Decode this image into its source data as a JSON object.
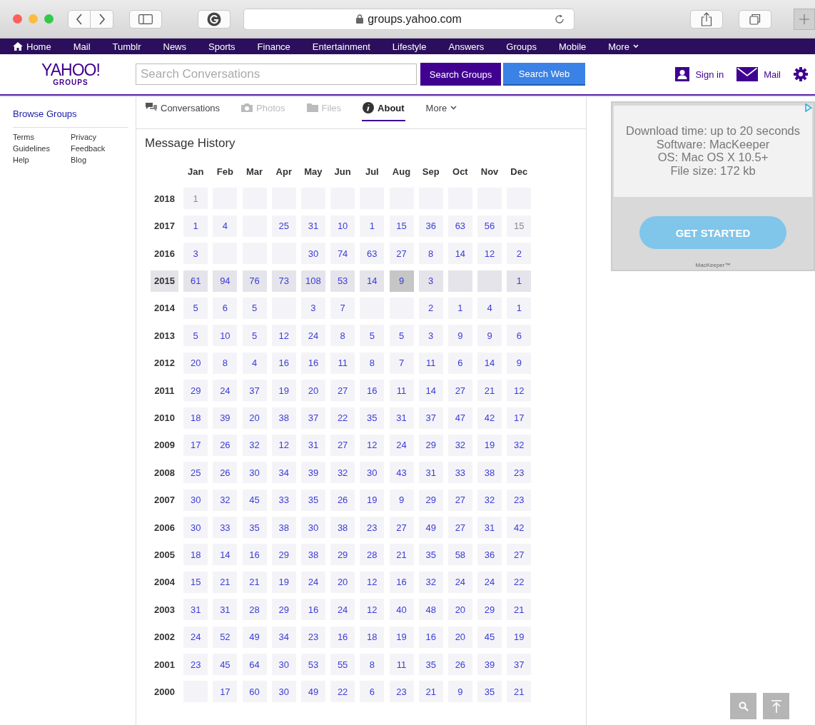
{
  "browser": {
    "address": "groups.yahoo.com"
  },
  "top_nav": [
    "Home",
    "Mail",
    "Tumblr",
    "News",
    "Sports",
    "Finance",
    "Entertainment",
    "Lifestyle",
    "Answers",
    "Groups",
    "Mobile",
    "More"
  ],
  "header": {
    "logo": "YAHOO!",
    "logo_sub": "GROUPS",
    "search": {
      "placeholder": "Search Conversations"
    },
    "buttons": [
      "Search Groups",
      "Search Web"
    ],
    "sign_in": "Sign in",
    "mail": "Mail"
  },
  "sidebar": {
    "title": "Browse Groups",
    "links": [
      "Terms",
      "Privacy",
      "Guidelines",
      "Feedback",
      "Help",
      "Blog"
    ]
  },
  "tabs": [
    {
      "label": "Conversations",
      "selected": false,
      "disabled": false
    },
    {
      "label": "Photos",
      "selected": false,
      "disabled": true
    },
    {
      "label": "Files",
      "selected": false,
      "disabled": true
    },
    {
      "label": "About",
      "selected": true,
      "disabled": false
    },
    {
      "label": "More",
      "selected": false,
      "disabled": false
    }
  ],
  "history": {
    "title": "Message History",
    "months": [
      "Jan",
      "Feb",
      "Mar",
      "Apr",
      "May",
      "Jun",
      "Jul",
      "Aug",
      "Sep",
      "Oct",
      "Nov",
      "Dec"
    ],
    "rows": [
      {
        "year": "2018",
        "selected": false,
        "cells": [
          {
            "kind": "count",
            "count": "1",
            "selected": false,
            "disabled": true
          },
          {
            "kind": "empty"
          },
          {
            "kind": "empty"
          },
          {
            "kind": "empty"
          },
          {
            "kind": "empty"
          },
          {
            "kind": "empty"
          },
          {
            "kind": "empty"
          },
          {
            "kind": "empty"
          },
          {
            "kind": "empty"
          },
          {
            "kind": "empty"
          },
          {
            "kind": "empty"
          },
          {
            "kind": "empty"
          }
        ]
      },
      {
        "year": "2017",
        "selected": false,
        "cells": [
          {
            "kind": "count",
            "count": "1",
            "selected": false,
            "disabled": false
          },
          {
            "kind": "count",
            "count": "4",
            "selected": false,
            "disabled": false
          },
          {
            "kind": "empty"
          },
          {
            "kind": "count",
            "count": "25",
            "selected": false,
            "disabled": false
          },
          {
            "kind": "count",
            "count": "31",
            "selected": false,
            "disabled": false
          },
          {
            "kind": "count",
            "count": "10",
            "selected": false,
            "disabled": false
          },
          {
            "kind": "count",
            "count": "1",
            "selected": false,
            "disabled": false
          },
          {
            "kind": "count",
            "count": "15",
            "selected": false,
            "disabled": false
          },
          {
            "kind": "count",
            "count": "36",
            "selected": false,
            "disabled": false
          },
          {
            "kind": "count",
            "count": "63",
            "selected": false,
            "disabled": false
          },
          {
            "kind": "count",
            "count": "56",
            "selected": false,
            "disabled": false
          },
          {
            "kind": "count",
            "count": "15",
            "selected": false,
            "disabled": true
          }
        ]
      },
      {
        "year": "2016",
        "selected": false,
        "cells": [
          {
            "kind": "count",
            "count": "3",
            "selected": false,
            "disabled": false
          },
          {
            "kind": "empty"
          },
          {
            "kind": "empty"
          },
          {
            "kind": "empty"
          },
          {
            "kind": "count",
            "count": "30",
            "selected": false,
            "disabled": false
          },
          {
            "kind": "count",
            "count": "74",
            "selected": false,
            "disabled": false
          },
          {
            "kind": "count",
            "count": "63",
            "selected": false,
            "disabled": false
          },
          {
            "kind": "count",
            "count": "27",
            "selected": false,
            "disabled": false
          },
          {
            "kind": "count",
            "count": "8",
            "selected": false,
            "disabled": false
          },
          {
            "kind": "count",
            "count": "14",
            "selected": false,
            "disabled": false
          },
          {
            "kind": "count",
            "count": "12",
            "selected": false,
            "disabled": false
          },
          {
            "kind": "count",
            "count": "2",
            "selected": false,
            "disabled": false
          }
        ]
      },
      {
        "year": "2015",
        "selected": true,
        "cells": [
          {
            "kind": "count",
            "count": "61",
            "selected": false,
            "disabled": false
          },
          {
            "kind": "count",
            "count": "94",
            "selected": false,
            "disabled": false
          },
          {
            "kind": "count",
            "count": "76",
            "selected": false,
            "disabled": false
          },
          {
            "kind": "count",
            "count": "73",
            "selected": false,
            "disabled": false
          },
          {
            "kind": "count",
            "count": "108",
            "selected": false,
            "disabled": false
          },
          {
            "kind": "count",
            "count": "53",
            "selected": false,
            "disabled": false
          },
          {
            "kind": "count",
            "count": "14",
            "selected": false,
            "disabled": false
          },
          {
            "kind": "count",
            "count": "9",
            "selected": true,
            "disabled": false
          },
          {
            "kind": "count",
            "count": "3",
            "selected": false,
            "disabled": false
          },
          {
            "kind": "empty"
          },
          {
            "kind": "empty"
          },
          {
            "kind": "count",
            "count": "1",
            "selected": false,
            "disabled": false
          }
        ]
      },
      {
        "year": "2014",
        "selected": false,
        "cells": [
          {
            "kind": "count",
            "count": "5",
            "selected": false,
            "disabled": false
          },
          {
            "kind": "count",
            "count": "6",
            "selected": false,
            "disabled": false
          },
          {
            "kind": "count",
            "count": "5",
            "selected": false,
            "disabled": false
          },
          {
            "kind": "empty"
          },
          {
            "kind": "count",
            "count": "3",
            "selected": false,
            "disabled": false
          },
          {
            "kind": "count",
            "count": "7",
            "selected": false,
            "disabled": false
          },
          {
            "kind": "empty"
          },
          {
            "kind": "empty"
          },
          {
            "kind": "count",
            "count": "2",
            "selected": false,
            "disabled": false
          },
          {
            "kind": "count",
            "count": "1",
            "selected": false,
            "disabled": false
          },
          {
            "kind": "count",
            "count": "4",
            "selected": false,
            "disabled": false
          },
          {
            "kind": "count",
            "count": "1",
            "selected": false,
            "disabled": false
          }
        ]
      },
      {
        "year": "2013",
        "selected": false,
        "cells": [
          {
            "kind": "count",
            "count": "5",
            "selected": false,
            "disabled": false
          },
          {
            "kind": "count",
            "count": "10",
            "selected": false,
            "disabled": false
          },
          {
            "kind": "count",
            "count": "5",
            "selected": false,
            "disabled": false
          },
          {
            "kind": "count",
            "count": "12",
            "selected": false,
            "disabled": false
          },
          {
            "kind": "count",
            "count": "24",
            "selected": false,
            "disabled": false
          },
          {
            "kind": "count",
            "count": "8",
            "selected": false,
            "disabled": false
          },
          {
            "kind": "count",
            "count": "5",
            "selected": false,
            "disabled": false
          },
          {
            "kind": "count",
            "count": "5",
            "selected": false,
            "disabled": false
          },
          {
            "kind": "count",
            "count": "3",
            "selected": false,
            "disabled": false
          },
          {
            "kind": "count",
            "count": "9",
            "selected": false,
            "disabled": false
          },
          {
            "kind": "count",
            "count": "9",
            "selected": false,
            "disabled": false
          },
          {
            "kind": "count",
            "count": "6",
            "selected": false,
            "disabled": false
          }
        ]
      },
      {
        "year": "2012",
        "selected": false,
        "cells": [
          {
            "kind": "count",
            "count": "20",
            "selected": false,
            "disabled": false
          },
          {
            "kind": "count",
            "count": "8",
            "selected": false,
            "disabled": false
          },
          {
            "kind": "count",
            "count": "4",
            "selected": false,
            "disabled": false
          },
          {
            "kind": "count",
            "count": "16",
            "selected": false,
            "disabled": false
          },
          {
            "kind": "count",
            "count": "16",
            "selected": false,
            "disabled": false
          },
          {
            "kind": "count",
            "count": "11",
            "selected": false,
            "disabled": false
          },
          {
            "kind": "count",
            "count": "8",
            "selected": false,
            "disabled": false
          },
          {
            "kind": "count",
            "count": "7",
            "selected": false,
            "disabled": false
          },
          {
            "kind": "count",
            "count": "11",
            "selected": false,
            "disabled": false
          },
          {
            "kind": "count",
            "count": "6",
            "selected": false,
            "disabled": false
          },
          {
            "kind": "count",
            "count": "14",
            "selected": false,
            "disabled": false
          },
          {
            "kind": "count",
            "count": "9",
            "selected": false,
            "disabled": false
          }
        ]
      },
      {
        "year": "2011",
        "selected": false,
        "cells": [
          {
            "kind": "count",
            "count": "29",
            "selected": false,
            "disabled": false
          },
          {
            "kind": "count",
            "count": "24",
            "selected": false,
            "disabled": false
          },
          {
            "kind": "count",
            "count": "37",
            "selected": false,
            "disabled": false
          },
          {
            "kind": "count",
            "count": "19",
            "selected": false,
            "disabled": false
          },
          {
            "kind": "count",
            "count": "20",
            "selected": false,
            "disabled": false
          },
          {
            "kind": "count",
            "count": "27",
            "selected": false,
            "disabled": false
          },
          {
            "kind": "count",
            "count": "16",
            "selected": false,
            "disabled": false
          },
          {
            "kind": "count",
            "count": "11",
            "selected": false,
            "disabled": false
          },
          {
            "kind": "count",
            "count": "14",
            "selected": false,
            "disabled": false
          },
          {
            "kind": "count",
            "count": "27",
            "selected": false,
            "disabled": false
          },
          {
            "kind": "count",
            "count": "21",
            "selected": false,
            "disabled": false
          },
          {
            "kind": "count",
            "count": "12",
            "selected": false,
            "disabled": false
          }
        ]
      },
      {
        "year": "2010",
        "selected": false,
        "cells": [
          {
            "kind": "count",
            "count": "18",
            "selected": false,
            "disabled": false
          },
          {
            "kind": "count",
            "count": "39",
            "selected": false,
            "disabled": false
          },
          {
            "kind": "count",
            "count": "20",
            "selected": false,
            "disabled": false
          },
          {
            "kind": "count",
            "count": "38",
            "selected": false,
            "disabled": false
          },
          {
            "kind": "count",
            "count": "37",
            "selected": false,
            "disabled": false
          },
          {
            "kind": "count",
            "count": "22",
            "selected": false,
            "disabled": false
          },
          {
            "kind": "count",
            "count": "35",
            "selected": false,
            "disabled": false
          },
          {
            "kind": "count",
            "count": "31",
            "selected": false,
            "disabled": false
          },
          {
            "kind": "count",
            "count": "37",
            "selected": false,
            "disabled": false
          },
          {
            "kind": "count",
            "count": "47",
            "selected": false,
            "disabled": false
          },
          {
            "kind": "count",
            "count": "42",
            "selected": false,
            "disabled": false
          },
          {
            "kind": "count",
            "count": "17",
            "selected": false,
            "disabled": false
          }
        ]
      },
      {
        "year": "2009",
        "selected": false,
        "cells": [
          {
            "kind": "count",
            "count": "17",
            "selected": false,
            "disabled": false
          },
          {
            "kind": "count",
            "count": "26",
            "selected": false,
            "disabled": false
          },
          {
            "kind": "count",
            "count": "32",
            "selected": false,
            "disabled": false
          },
          {
            "kind": "count",
            "count": "12",
            "selected": false,
            "disabled": false
          },
          {
            "kind": "count",
            "count": "31",
            "selected": false,
            "disabled": false
          },
          {
            "kind": "count",
            "count": "27",
            "selected": false,
            "disabled": false
          },
          {
            "kind": "count",
            "count": "12",
            "selected": false,
            "disabled": false
          },
          {
            "kind": "count",
            "count": "24",
            "selected": false,
            "disabled": false
          },
          {
            "kind": "count",
            "count": "29",
            "selected": false,
            "disabled": false
          },
          {
            "kind": "count",
            "count": "32",
            "selected": false,
            "disabled": false
          },
          {
            "kind": "count",
            "count": "19",
            "selected": false,
            "disabled": false
          },
          {
            "kind": "count",
            "count": "32",
            "selected": false,
            "disabled": false
          }
        ]
      },
      {
        "year": "2008",
        "selected": false,
        "cells": [
          {
            "kind": "count",
            "count": "25",
            "selected": false,
            "disabled": false
          },
          {
            "kind": "count",
            "count": "26",
            "selected": false,
            "disabled": false
          },
          {
            "kind": "count",
            "count": "30",
            "selected": false,
            "disabled": false
          },
          {
            "kind": "count",
            "count": "34",
            "selected": false,
            "disabled": false
          },
          {
            "kind": "count",
            "count": "39",
            "selected": false,
            "disabled": false
          },
          {
            "kind": "count",
            "count": "32",
            "selected": false,
            "disabled": false
          },
          {
            "kind": "count",
            "count": "30",
            "selected": false,
            "disabled": false
          },
          {
            "kind": "count",
            "count": "43",
            "selected": false,
            "disabled": false
          },
          {
            "kind": "count",
            "count": "31",
            "selected": false,
            "disabled": false
          },
          {
            "kind": "count",
            "count": "33",
            "selected": false,
            "disabled": false
          },
          {
            "kind": "count",
            "count": "38",
            "selected": false,
            "disabled": false
          },
          {
            "kind": "count",
            "count": "23",
            "selected": false,
            "disabled": false
          }
        ]
      },
      {
        "year": "2007",
        "selected": false,
        "cells": [
          {
            "kind": "count",
            "count": "30",
            "selected": false,
            "disabled": false
          },
          {
            "kind": "count",
            "count": "32",
            "selected": false,
            "disabled": false
          },
          {
            "kind": "count",
            "count": "45",
            "selected": false,
            "disabled": false
          },
          {
            "kind": "count",
            "count": "33",
            "selected": false,
            "disabled": false
          },
          {
            "kind": "count",
            "count": "35",
            "selected": false,
            "disabled": false
          },
          {
            "kind": "count",
            "count": "26",
            "selected": false,
            "disabled": false
          },
          {
            "kind": "count",
            "count": "19",
            "selected": false,
            "disabled": false
          },
          {
            "kind": "count",
            "count": "9",
            "selected": false,
            "disabled": false
          },
          {
            "kind": "count",
            "count": "29",
            "selected": false,
            "disabled": false
          },
          {
            "kind": "count",
            "count": "27",
            "selected": false,
            "disabled": false
          },
          {
            "kind": "count",
            "count": "32",
            "selected": false,
            "disabled": false
          },
          {
            "kind": "count",
            "count": "23",
            "selected": false,
            "disabled": false
          }
        ]
      },
      {
        "year": "2006",
        "selected": false,
        "cells": [
          {
            "kind": "count",
            "count": "30",
            "selected": false,
            "disabled": false
          },
          {
            "kind": "count",
            "count": "33",
            "selected": false,
            "disabled": false
          },
          {
            "kind": "count",
            "count": "35",
            "selected": false,
            "disabled": false
          },
          {
            "kind": "count",
            "count": "38",
            "selected": false,
            "disabled": false
          },
          {
            "kind": "count",
            "count": "30",
            "selected": false,
            "disabled": false
          },
          {
            "kind": "count",
            "count": "38",
            "selected": false,
            "disabled": false
          },
          {
            "kind": "count",
            "count": "23",
            "selected": false,
            "disabled": false
          },
          {
            "kind": "count",
            "count": "27",
            "selected": false,
            "disabled": false
          },
          {
            "kind": "count",
            "count": "49",
            "selected": false,
            "disabled": false
          },
          {
            "kind": "count",
            "count": "27",
            "selected": false,
            "disabled": false
          },
          {
            "kind": "count",
            "count": "31",
            "selected": false,
            "disabled": false
          },
          {
            "kind": "count",
            "count": "42",
            "selected": false,
            "disabled": false
          }
        ]
      },
      {
        "year": "2005",
        "selected": false,
        "cells": [
          {
            "kind": "count",
            "count": "18",
            "selected": false,
            "disabled": false
          },
          {
            "kind": "count",
            "count": "14",
            "selected": false,
            "disabled": false
          },
          {
            "kind": "count",
            "count": "16",
            "selected": false,
            "disabled": false
          },
          {
            "kind": "count",
            "count": "29",
            "selected": false,
            "disabled": false
          },
          {
            "kind": "count",
            "count": "38",
            "selected": false,
            "disabled": false
          },
          {
            "kind": "count",
            "count": "29",
            "selected": false,
            "disabled": false
          },
          {
            "kind": "count",
            "count": "28",
            "selected": false,
            "disabled": false
          },
          {
            "kind": "count",
            "count": "21",
            "selected": false,
            "disabled": false
          },
          {
            "kind": "count",
            "count": "35",
            "selected": false,
            "disabled": false
          },
          {
            "kind": "count",
            "count": "58",
            "selected": false,
            "disabled": false
          },
          {
            "kind": "count",
            "count": "36",
            "selected": false,
            "disabled": false
          },
          {
            "kind": "count",
            "count": "27",
            "selected": false,
            "disabled": false
          }
        ]
      },
      {
        "year": "2004",
        "selected": false,
        "cells": [
          {
            "kind": "count",
            "count": "15",
            "selected": false,
            "disabled": false
          },
          {
            "kind": "count",
            "count": "21",
            "selected": false,
            "disabled": false
          },
          {
            "kind": "count",
            "count": "21",
            "selected": false,
            "disabled": false
          },
          {
            "kind": "count",
            "count": "19",
            "selected": false,
            "disabled": false
          },
          {
            "kind": "count",
            "count": "24",
            "selected": false,
            "disabled": false
          },
          {
            "kind": "count",
            "count": "20",
            "selected": false,
            "disabled": false
          },
          {
            "kind": "count",
            "count": "12",
            "selected": false,
            "disabled": false
          },
          {
            "kind": "count",
            "count": "16",
            "selected": false,
            "disabled": false
          },
          {
            "kind": "count",
            "count": "32",
            "selected": false,
            "disabled": false
          },
          {
            "kind": "count",
            "count": "24",
            "selected": false,
            "disabled": false
          },
          {
            "kind": "count",
            "count": "24",
            "selected": false,
            "disabled": false
          },
          {
            "kind": "count",
            "count": "22",
            "selected": false,
            "disabled": false
          }
        ]
      },
      {
        "year": "2003",
        "selected": false,
        "cells": [
          {
            "kind": "count",
            "count": "31",
            "selected": false,
            "disabled": false
          },
          {
            "kind": "count",
            "count": "31",
            "selected": false,
            "disabled": false
          },
          {
            "kind": "count",
            "count": "28",
            "selected": false,
            "disabled": false
          },
          {
            "kind": "count",
            "count": "29",
            "selected": false,
            "disabled": false
          },
          {
            "kind": "count",
            "count": "16",
            "selected": false,
            "disabled": false
          },
          {
            "kind": "count",
            "count": "24",
            "selected": false,
            "disabled": false
          },
          {
            "kind": "count",
            "count": "12",
            "selected": false,
            "disabled": false
          },
          {
            "kind": "count",
            "count": "40",
            "selected": false,
            "disabled": false
          },
          {
            "kind": "count",
            "count": "48",
            "selected": false,
            "disabled": false
          },
          {
            "kind": "count",
            "count": "20",
            "selected": false,
            "disabled": false
          },
          {
            "kind": "count",
            "count": "29",
            "selected": false,
            "disabled": false
          },
          {
            "kind": "count",
            "count": "21",
            "selected": false,
            "disabled": false
          }
        ]
      },
      {
        "year": "2002",
        "selected": false,
        "cells": [
          {
            "kind": "count",
            "count": "24",
            "selected": false,
            "disabled": false
          },
          {
            "kind": "count",
            "count": "52",
            "selected": false,
            "disabled": false
          },
          {
            "kind": "count",
            "count": "49",
            "selected": false,
            "disabled": false
          },
          {
            "kind": "count",
            "count": "34",
            "selected": false,
            "disabled": false
          },
          {
            "kind": "count",
            "count": "23",
            "selected": false,
            "disabled": false
          },
          {
            "kind": "count",
            "count": "16",
            "selected": false,
            "disabled": false
          },
          {
            "kind": "count",
            "count": "18",
            "selected": false,
            "disabled": false
          },
          {
            "kind": "count",
            "count": "19",
            "selected": false,
            "disabled": false
          },
          {
            "kind": "count",
            "count": "16",
            "selected": false,
            "disabled": false
          },
          {
            "kind": "count",
            "count": "20",
            "selected": false,
            "disabled": false
          },
          {
            "kind": "count",
            "count": "45",
            "selected": false,
            "disabled": false
          },
          {
            "kind": "count",
            "count": "19",
            "selected": false,
            "disabled": false
          }
        ]
      },
      {
        "year": "2001",
        "selected": false,
        "cells": [
          {
            "kind": "count",
            "count": "23",
            "selected": false,
            "disabled": false
          },
          {
            "kind": "count",
            "count": "45",
            "selected": false,
            "disabled": false
          },
          {
            "kind": "count",
            "count": "64",
            "selected": false,
            "disabled": false
          },
          {
            "kind": "count",
            "count": "30",
            "selected": false,
            "disabled": false
          },
          {
            "kind": "count",
            "count": "53",
            "selected": false,
            "disabled": false
          },
          {
            "kind": "count",
            "count": "55",
            "selected": false,
            "disabled": false
          },
          {
            "kind": "count",
            "count": "8",
            "selected": false,
            "disabled": false
          },
          {
            "kind": "count",
            "count": "11",
            "selected": false,
            "disabled": false
          },
          {
            "kind": "count",
            "count": "35",
            "selected": false,
            "disabled": false
          },
          {
            "kind": "count",
            "count": "26",
            "selected": false,
            "disabled": false
          },
          {
            "kind": "count",
            "count": "39",
            "selected": false,
            "disabled": false
          },
          {
            "kind": "count",
            "count": "37",
            "selected": false,
            "disabled": false
          }
        ]
      },
      {
        "year": "2000",
        "selected": false,
        "cells": [
          {
            "kind": "empty"
          },
          {
            "kind": "count",
            "count": "17",
            "selected": false,
            "disabled": false
          },
          {
            "kind": "count",
            "count": "60",
            "selected": false,
            "disabled": false
          },
          {
            "kind": "count",
            "count": "30",
            "selected": false,
            "disabled": false
          },
          {
            "kind": "count",
            "count": "49",
            "selected": false,
            "disabled": false
          },
          {
            "kind": "count",
            "count": "22",
            "selected": false,
            "disabled": false
          },
          {
            "kind": "count",
            "count": "6",
            "selected": false,
            "disabled": false
          },
          {
            "kind": "count",
            "count": "23",
            "selected": false,
            "disabled": false
          },
          {
            "kind": "count",
            "count": "21",
            "selected": false,
            "disabled": false
          },
          {
            "kind": "count",
            "count": "9",
            "selected": false,
            "disabled": false
          },
          {
            "kind": "count",
            "count": "35",
            "selected": false,
            "disabled": false
          },
          {
            "kind": "count",
            "count": "21",
            "selected": false,
            "disabled": false
          }
        ]
      }
    ]
  },
  "ad": {
    "lines": [
      "Download time: up to 20 seconds",
      "Software: MacKeeper",
      "OS: Mac OS X 10.5+",
      "File size: 172 kb"
    ],
    "button": "GET STARTED",
    "brand": "MacKeeper™"
  }
}
